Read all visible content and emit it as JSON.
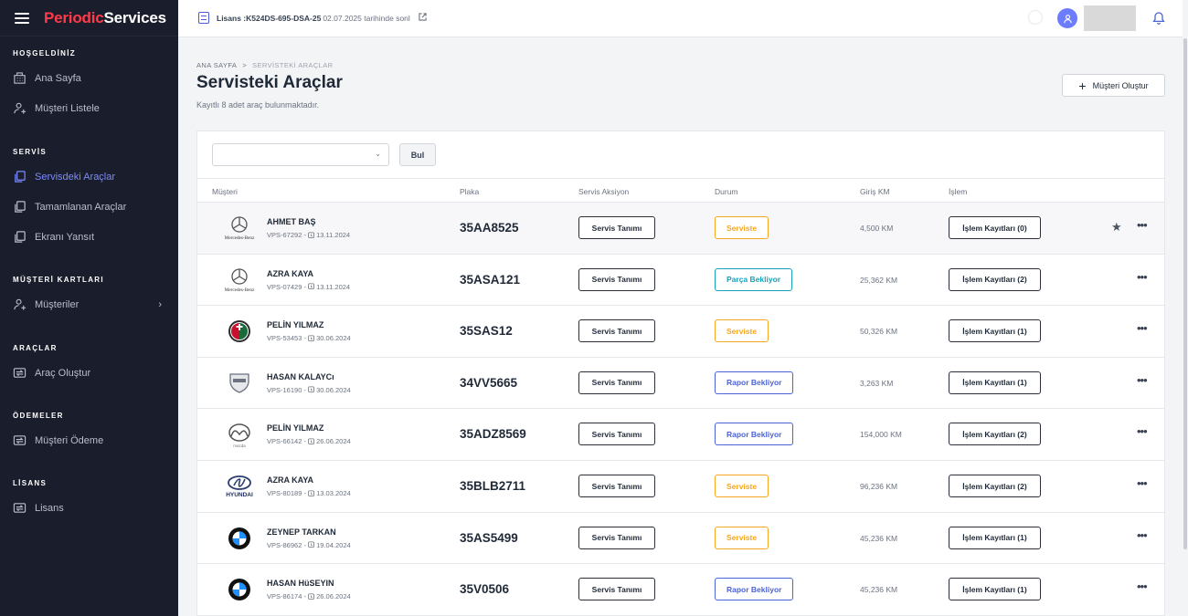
{
  "brand": {
    "part1": "Periodic",
    "part2": "Services"
  },
  "sidebar": {
    "sections": [
      {
        "title": "HOŞGELDİNİZ",
        "items": [
          {
            "label": "Ana Sayfa",
            "icon": "building-icon"
          },
          {
            "label": "Müşteri Listele",
            "icon": "user-icon"
          }
        ]
      },
      {
        "title": "SERVİS",
        "items": [
          {
            "label": "Servisdeki Araçlar",
            "icon": "copy-icon",
            "active": true
          },
          {
            "label": "Tamamlanan Araçlar",
            "icon": "copy-icon"
          },
          {
            "label": "Ekranı Yansıt",
            "icon": "copy-icon"
          }
        ]
      },
      {
        "title": "MÜŞTERİ KARTLARI",
        "items": [
          {
            "label": "Müşteriler",
            "icon": "user-icon",
            "chevron": "›"
          }
        ]
      },
      {
        "title": "ARAÇLAR",
        "items": [
          {
            "label": "Araç Oluştur",
            "icon": "swap-icon"
          }
        ]
      },
      {
        "title": "ÖDEMELER",
        "items": [
          {
            "label": "Müşteri Ödeme",
            "icon": "swap-icon"
          }
        ]
      },
      {
        "title": "LİSANS",
        "items": [
          {
            "label": "Lisans",
            "icon": "swap-icon"
          }
        ]
      }
    ]
  },
  "topbar": {
    "license_key": "Lisans :K524DS-695-DSA-25",
    "license_date": "02.07.2025 tarihinde sonl",
    "avatar_icon": "user-icon",
    "bell_icon": "bell-icon"
  },
  "breadcrumb": {
    "home": "ANA SAYFA",
    "separator": ">",
    "current": "SERVİSTEKİ ARAÇLAR"
  },
  "page": {
    "title": "Servisteki Araçlar",
    "subtitle": "Kayıtlı 8 adet araç bulunmaktadır.",
    "create_button": "Müşteri Oluştur",
    "create_icon": "+"
  },
  "filter": {
    "select_value": "",
    "search_button": "Bul"
  },
  "table": {
    "headers": {
      "customer": "Müşteri",
      "plate": "Plaka",
      "action": "Servis Aksiyon",
      "status": "Durum",
      "km": "Giriş KM",
      "process": "İşlem"
    },
    "service_button": "Servis Tanımı",
    "status_colors": {
      "Serviste": "#f5a623",
      "Parça Bekliyor": "#17a2b8",
      "Rapor Bekliyor": "#4b63d8"
    },
    "rows": [
      {
        "logo": "mercedes",
        "logo_text": "Mercedes-Benz",
        "name": "AHMET BAŞ",
        "code": "VPS-67292 -",
        "date": "13.11.2024",
        "plate": "35AA8525",
        "status": "Serviste",
        "km": "4,500 KM",
        "records": "İşlem Kayıtları (0)",
        "starred": true,
        "highlight": true
      },
      {
        "logo": "mercedes",
        "logo_text": "Mercedes-Benz",
        "name": "AZRA KAYA",
        "code": "VPS-07429 -",
        "date": "13.11.2024",
        "plate": "35ASA121",
        "status": "Parça Bekliyor",
        "km": "25,362 KM",
        "records": "İşlem Kayıtları (2)"
      },
      {
        "logo": "alfa",
        "name": "PELİN YILMAZ",
        "code": "VPS-53453 -",
        "date": "30.06.2024",
        "plate": "35SAS12",
        "status": "Serviste",
        "km": "50,326 KM",
        "records": "İşlem Kayıtları (1)"
      },
      {
        "logo": "dacia",
        "name": "HASAN KALAYCı",
        "code": "VPS-16190 -",
        "date": "30.06.2024",
        "plate": "34VV5665",
        "status": "Rapor Bekliyor",
        "km": "3,263 KM",
        "records": "İşlem Kayıtları (1)"
      },
      {
        "logo": "mazda",
        "name": "PELİN YILMAZ",
        "code": "VPS-66142 -",
        "date": "26.06.2024",
        "plate": "35ADZ8569",
        "status": "Rapor Bekliyor",
        "km": "154,000 KM",
        "records": "İşlem Kayıtları (2)"
      },
      {
        "logo": "hyundai",
        "logo_text": "HYUNDAI",
        "name": "AZRA KAYA",
        "code": "VPS-80189 -",
        "date": "13.03.2024",
        "plate": "35BLB2711",
        "status": "Serviste",
        "km": "96,236 KM",
        "records": "İşlem Kayıtları (2)"
      },
      {
        "logo": "bmw",
        "name": "ZEYNEP TARKAN",
        "code": "VPS-86962 -",
        "date": "19.04.2024",
        "plate": "35AS5499",
        "status": "Serviste",
        "km": "45,236 KM",
        "records": "İşlem Kayıtları (1)"
      },
      {
        "logo": "bmw",
        "name": "HASAN HüSEYIN",
        "code": "VPS-86174 -",
        "date": "26.06.2024",
        "plate": "35V0506",
        "status": "Rapor Bekliyor",
        "km": "45,236 KM",
        "records": "İşlem Kayıtları (1)"
      }
    ]
  }
}
